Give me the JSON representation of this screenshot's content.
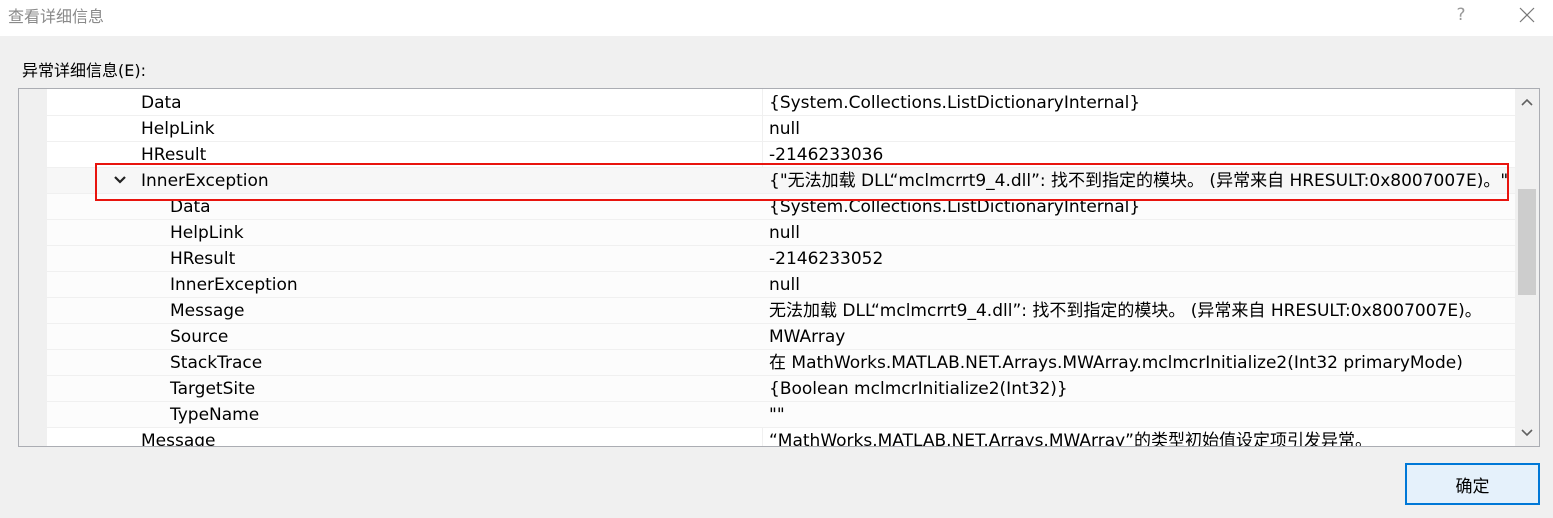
{
  "window": {
    "title": "查看详细信息",
    "help_label": "?",
    "close_icon": "close-icon"
  },
  "section": {
    "label": "异常详细信息(E):"
  },
  "tree": {
    "rows": [
      {
        "name": "Data",
        "value": "{System.Collections.ListDictionaryInternal}",
        "level": 0
      },
      {
        "name": "HelpLink",
        "value": "null",
        "level": 0
      },
      {
        "name": "HResult",
        "value": "-2146233036",
        "level": 0
      },
      {
        "name": "InnerException",
        "value": "{\"无法加载 DLL“mclmcrrt9_4.dll”: 找不到指定的模块。 (异常来自 HRESULT:0x8007007E)。\"",
        "level": 0,
        "expanded": true
      },
      {
        "name": "Data",
        "value": "{System.Collections.ListDictionaryInternal}",
        "level": 1
      },
      {
        "name": "HelpLink",
        "value": "null",
        "level": 1
      },
      {
        "name": "HResult",
        "value": "-2146233052",
        "level": 1
      },
      {
        "name": "InnerException",
        "value": "null",
        "level": 1
      },
      {
        "name": "Message",
        "value": "无法加载 DLL“mclmcrrt9_4.dll”: 找不到指定的模块。 (异常来自 HRESULT:0x8007007E)。",
        "level": 1
      },
      {
        "name": "Source",
        "value": "MWArray",
        "level": 1
      },
      {
        "name": "StackTrace",
        "value": "   在 MathWorks.MATLAB.NET.Arrays.MWArray.mclmcrInitialize2(Int32 primaryMode)",
        "level": 1
      },
      {
        "name": "TargetSite",
        "value": "{Boolean mclmcrInitialize2(Int32)}",
        "level": 1
      },
      {
        "name": "TypeName",
        "value": "\"\"",
        "level": 1
      },
      {
        "name": "Message",
        "value": "“MathWorks.MATLAB.NET.Arrays.MWArray”的类型初始值设定项引发异常。",
        "level": 0
      }
    ]
  },
  "scrollbar": {
    "up_icon": "chevron-up-icon",
    "down_icon": "chevron-down-icon"
  },
  "buttons": {
    "ok_label": "确定"
  },
  "colors": {
    "highlight_border": "#e8140e",
    "ok_button_border": "#0078d7",
    "ok_button_bg": "#e5f1fb"
  }
}
